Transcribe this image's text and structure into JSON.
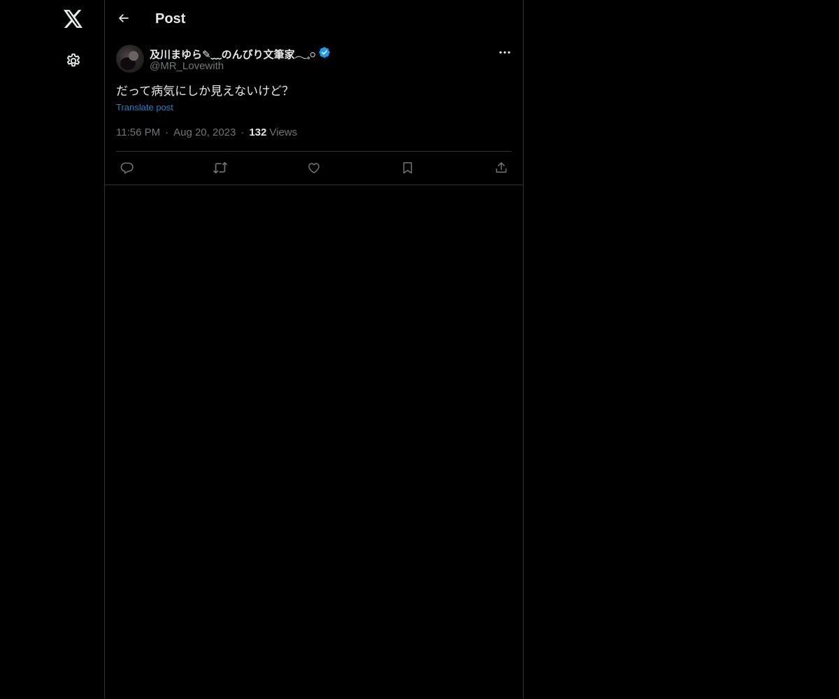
{
  "nav": {
    "logo_icon": "x-logo-icon",
    "settings_icon": "gear-icon"
  },
  "header": {
    "back_icon": "arrow-left-icon",
    "title": "Post"
  },
  "post": {
    "author": {
      "display_name": "及川まゆら✎﹏のんびり文筆家𓂃𓈒𓏸",
      "handle": "@MR_Lovewith",
      "verified": true,
      "verified_color": "#1d9bf0"
    },
    "text": "だって病気にしか見えないけど？",
    "translate_label": "Translate post",
    "time": "11:56 PM",
    "date": "Aug 20, 2023",
    "separator": "·",
    "views_count": "132",
    "views_label": "Views",
    "actions": [
      {
        "name": "reply",
        "icon": "reply-icon"
      },
      {
        "name": "repost",
        "icon": "repost-icon"
      },
      {
        "name": "like",
        "icon": "heart-icon"
      },
      {
        "name": "bookmark",
        "icon": "bookmark-icon"
      },
      {
        "name": "share",
        "icon": "share-icon"
      }
    ]
  },
  "colors": {
    "background": "#000000",
    "text_primary": "#e7e9ea",
    "text_secondary": "#71767b",
    "border": "#2f3336",
    "accent": "#1d9bf0"
  }
}
